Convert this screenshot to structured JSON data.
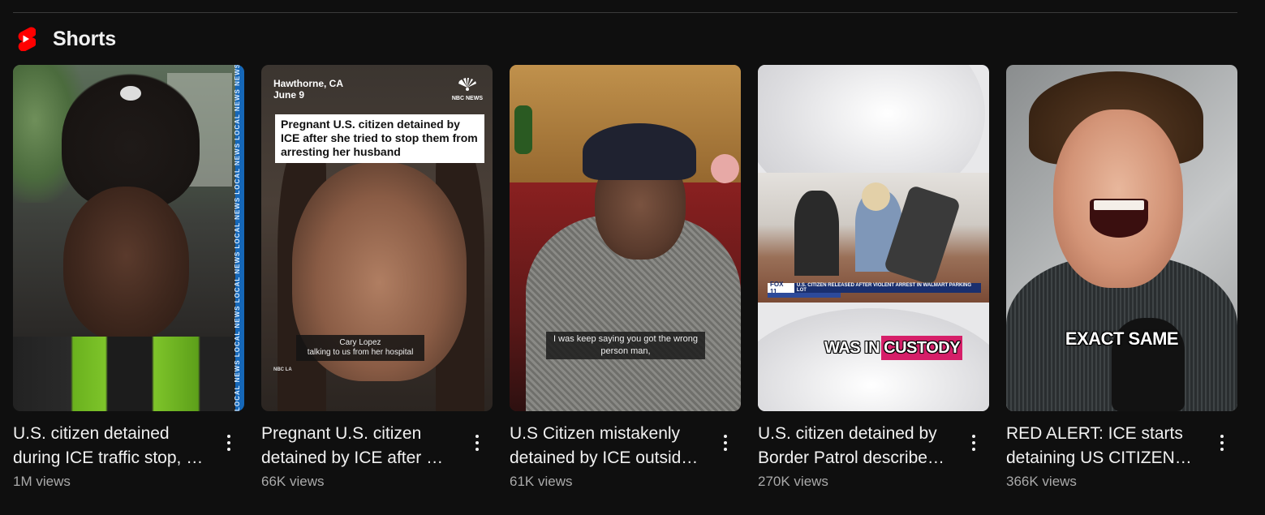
{
  "shelf": {
    "title": "Shorts",
    "icon": "shorts-logo-icon",
    "accent": "#ff0000"
  },
  "cards": [
    {
      "title": "U.S. citizen detained during ICE traffic stop, …",
      "views": "1M views",
      "thumb": {
        "stripe_text": "LOCAL NEWS   LOCAL NEWS   LOCAL NEWS   LOCAL NEWS   LOCAL NEWS   LOCAL NEWS   NEWS"
      }
    },
    {
      "title": "Pregnant U.S. citizen detained by ICE after …",
      "views": "66K views",
      "thumb": {
        "location": "Hawthorne, CA",
        "date": "June 9",
        "logo_text": "NBC NEWS",
        "headline": "Pregnant U.S. citizen detained by ICE after she tried to stop them from arresting her husband",
        "lower_name": "Cary Lopez",
        "lower_desc": "talking to us from her hospital",
        "station": "NBC LA"
      }
    },
    {
      "title": "U.S Citizen mistakenly detained by ICE outsid…",
      "views": "61K views",
      "thumb": {
        "subtitle": "I was keep saying you got the wrong person man,"
      }
    },
    {
      "title": "U.S. citizen detained by Border Patrol describe…",
      "views": "270K views",
      "thumb": {
        "channel": "FOX 11",
        "chyron": "U.S. CITIZEN RELEASED AFTER VIOLENT ARREST IN WALMART PARKING LOT",
        "caption_a": "WAS IN",
        "caption_b": "CUSTODY"
      }
    },
    {
      "title": "RED ALERT: ICE starts detaining US CITIZEN…",
      "views": "366K views",
      "thumb": {
        "caption": "EXACT SAME"
      }
    }
  ]
}
